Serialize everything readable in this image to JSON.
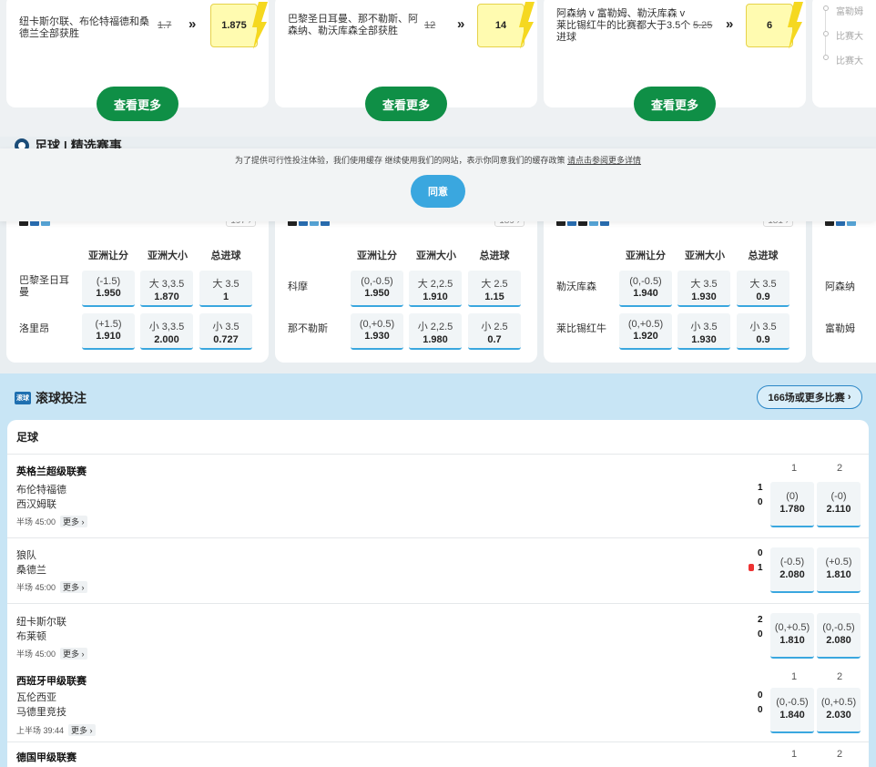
{
  "promos": [
    {
      "text": "纽卡斯尔联、布伦特福德和桑德兰全部获胜",
      "old_odds": "1.7",
      "boost_odds": "1.875",
      "cta": "查看更多"
    },
    {
      "text": "巴黎圣日耳曼、那不勒斯、阿森纳、勒沃库森全部获胜",
      "old_odds": "12",
      "boost_odds": "14",
      "cta": "查看更多"
    },
    {
      "text": "阿森纳 v 富勒姆、勒沃库森 v 莱比锡红牛的比赛都大于3.5个进球",
      "old_odds": "5.25",
      "boost_odds": "6",
      "cta": "查看更多"
    }
  ],
  "partial_timeline": [
    "富勒姆",
    "比赛大",
    "比赛大"
  ],
  "featured_title": "足球 | 精选赛事",
  "cookie": {
    "text": "为了提供可行性投注体验，我们使用缓存 继续使用我们的网站，表示你同意我们的缓存政策",
    "link": "请点击参阅更多详情",
    "agree": "同意"
  },
  "featured": [
    {
      "count": "197",
      "headers": [
        "亚洲让分",
        "亚洲大小",
        "总进球"
      ],
      "teams": [
        "巴黎圣日耳曼",
        "洛里昂"
      ],
      "odds": [
        [
          {
            "h": "(-1.5)",
            "v": "1.950"
          },
          {
            "h": "大 3,3.5",
            "v": "1.870"
          },
          {
            "h": "大 3.5",
            "v": "1"
          }
        ],
        [
          {
            "h": "(+1.5)",
            "v": "1.910"
          },
          {
            "h": "小 3,3.5",
            "v": "2.000"
          },
          {
            "h": "小 3.5",
            "v": "0.727"
          }
        ]
      ]
    },
    {
      "count": "189",
      "headers": [
        "亚洲让分",
        "亚洲大小",
        "总进球"
      ],
      "teams": [
        "科摩",
        "那不勒斯"
      ],
      "odds": [
        [
          {
            "h": "(0,-0.5)",
            "v": "1.950"
          },
          {
            "h": "大 2,2.5",
            "v": "1.910"
          },
          {
            "h": "大 2.5",
            "v": "1.15"
          }
        ],
        [
          {
            "h": "(0,+0.5)",
            "v": "1.930"
          },
          {
            "h": "小 2,2.5",
            "v": "1.980"
          },
          {
            "h": "小 2.5",
            "v": "0.7"
          }
        ]
      ]
    },
    {
      "count": "181",
      "headers": [
        "亚洲让分",
        "亚洲大小",
        "总进球"
      ],
      "teams": [
        "勒沃库森",
        "莱比锡红牛"
      ],
      "odds": [
        [
          {
            "h": "(0,-0.5)",
            "v": "1.940"
          },
          {
            "h": "大 3.5",
            "v": "1.930"
          },
          {
            "h": "大 3.5",
            "v": "0.9"
          }
        ],
        [
          {
            "h": "(0,+0.5)",
            "v": "1.920"
          },
          {
            "h": "小 3.5",
            "v": "1.930"
          },
          {
            "h": "小 3.5",
            "v": "0.9"
          }
        ]
      ]
    }
  ],
  "partial_featured_teams": [
    "阿森纳",
    "富勒姆"
  ],
  "live": {
    "title": "滚球投注",
    "icon_text": "滚球",
    "more": "166场或更多比赛",
    "sport": "足球",
    "col1": "1",
    "col2": "2",
    "more_label": "更多",
    "leagues": [
      {
        "name": "英格兰超级联赛"
      },
      {
        "name": "西班牙甲级联赛"
      },
      {
        "name": "德国甲级联赛"
      }
    ],
    "matches": [
      {
        "home": "布伦特福德",
        "away": "西汉姆联",
        "score_home": "1",
        "score_away": "0",
        "time": "半场 45:00",
        "o1h": "(0)",
        "o1v": "1.780",
        "o2h": "(-0)",
        "o2v": "2.110"
      },
      {
        "home": "狼队",
        "away": "桑德兰",
        "score_home": "0",
        "score_away": "1",
        "time": "半场 45:00",
        "o1h": "(-0.5)",
        "o1v": "2.080",
        "o2h": "(+0.5)",
        "o2v": "1.810"
      },
      {
        "home": "纽卡斯尔联",
        "away": "布莱顿",
        "score_home": "2",
        "score_away": "0",
        "time": "半场 45:00",
        "o1h": "(0,+0.5)",
        "o1v": "1.810",
        "o2h": "(0,-0.5)",
        "o2v": "2.080"
      },
      {
        "home": "瓦伦西亚",
        "away": "马德里竞技",
        "score_home": "0",
        "score_away": "0",
        "time": "上半场 39:44",
        "o1h": "(0,-0.5)",
        "o1v": "1.840",
        "o2h": "(0,+0.5)",
        "o2v": "2.030"
      }
    ]
  }
}
